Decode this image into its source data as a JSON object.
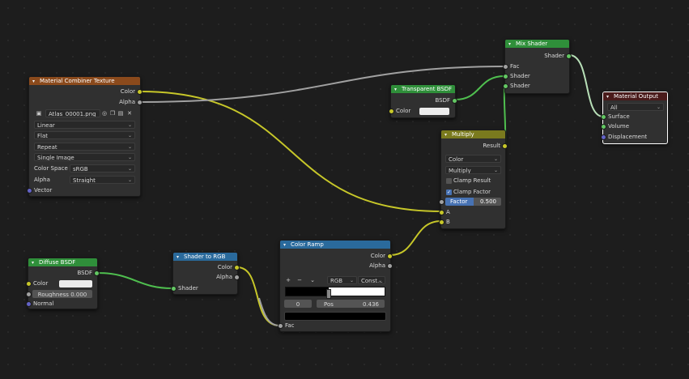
{
  "colors": {
    "texture_header": "#8b4a1c",
    "shader_header": "#2f8f3a",
    "converter_header": "#2a6a9c",
    "color_header": "#7a7a1e",
    "output_header": "#4a1b1b",
    "link_color": "#c7c729",
    "link_shader": "#4fbf4f",
    "link_gray": "#a1a1a1"
  },
  "nodes": {
    "material_combiner": {
      "title": "Material Combiner Texture",
      "out_color": "Color",
      "out_alpha": "Alpha",
      "image_name": "Atlas_00001.png",
      "interpolation": "Linear",
      "projection": "Flat",
      "extension": "Repeat",
      "source": "Single Image",
      "color_space_label": "Color Space",
      "color_space": "sRGB",
      "alpha_label": "Alpha",
      "alpha_mode": "Straight",
      "in_vector": "Vector"
    },
    "transparent_bsdf": {
      "title": "Transparent BSDF",
      "out_bsdf": "BSDF",
      "in_color": "Color"
    },
    "mix_shader": {
      "title": "Mix Shader",
      "out_shader": "Shader",
      "in_fac": "Fac",
      "in_shader1": "Shader",
      "in_shader2": "Shader"
    },
    "material_output": {
      "title": "Material Output",
      "target": "All",
      "in_surface": "Surface",
      "in_volume": "Volume",
      "in_displacement": "Displacement"
    },
    "multiply": {
      "title": "Multiply",
      "out_result": "Result",
      "data_type": "Color",
      "blend_type": "Multiply",
      "clamp_result": "Clamp Result",
      "clamp_factor": "Clamp Factor",
      "factor_label": "Factor",
      "factor_value": "0.500",
      "factor_fraction": 0.5,
      "in_a": "A",
      "in_b": "B"
    },
    "diffuse_bsdf": {
      "title": "Diffuse BSDF",
      "out_bsdf": "BSDF",
      "in_color": "Color",
      "roughness_label": "Roughness",
      "roughness_value": "0.000",
      "in_normal": "Normal"
    },
    "shader_to_rgb": {
      "title": "Shader to RGB",
      "out_color": "Color",
      "out_alpha": "Alpha",
      "in_shader": "Shader"
    },
    "color_ramp": {
      "title": "Color Ramp",
      "out_color": "Color",
      "out_alpha": "Alpha",
      "color_mode": "RGB",
      "interpolation": "Const...",
      "stop_index": "0",
      "pos_label": "Pos",
      "pos_value": "0.436",
      "pos_fraction": 0.436,
      "in_fac": "Fac"
    }
  }
}
